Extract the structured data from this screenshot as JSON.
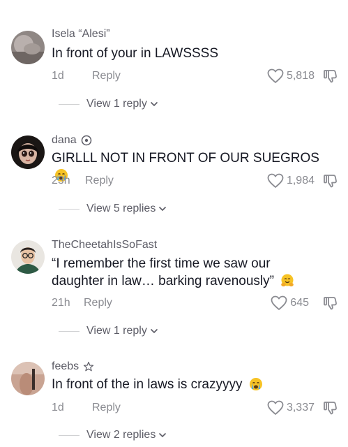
{
  "comments": [
    {
      "username": "Isela “Alesi”",
      "badge": "",
      "text": "In front of your in LAWSSSS",
      "emoji": "",
      "time": "1d",
      "reply_label": "Reply",
      "likes": "5,818",
      "view_replies": "View 1 reply",
      "avatar_icon": "user-avatar-photo"
    },
    {
      "username": "dana",
      "badge": "verified-gear-icon",
      "text": "GIRLLL NOT IN FRONT OF OUR SUEGROS",
      "emoji": "crying-face-emoji",
      "time": "23h",
      "reply_label": "Reply",
      "likes": "1,984",
      "view_replies": "View 5 replies",
      "avatar_icon": "doll-avatar-photo"
    },
    {
      "username": "TheCheetahIsSoFast",
      "badge": "",
      "text": "“I remember the first time we saw our daughter in law… barking ravenously”",
      "emoji": "hugging-face-emoji",
      "time": "21h",
      "reply_label": "Reply",
      "likes": "645",
      "view_replies": "View 1 reply",
      "avatar_icon": "cartoon-avatar-photo"
    },
    {
      "username": "feebs",
      "badge": "star-icon",
      "text": "In front of the in laws is crazyyyy",
      "emoji": "crying-face-emoji",
      "time": "1d",
      "reply_label": "Reply",
      "likes": "3,337",
      "view_replies": "View 2 replies",
      "avatar_icon": "user-avatar-photo"
    }
  ],
  "colors": {
    "text_primary": "#161823",
    "text_secondary": "#8a8b91",
    "username": "#5c5c66"
  }
}
